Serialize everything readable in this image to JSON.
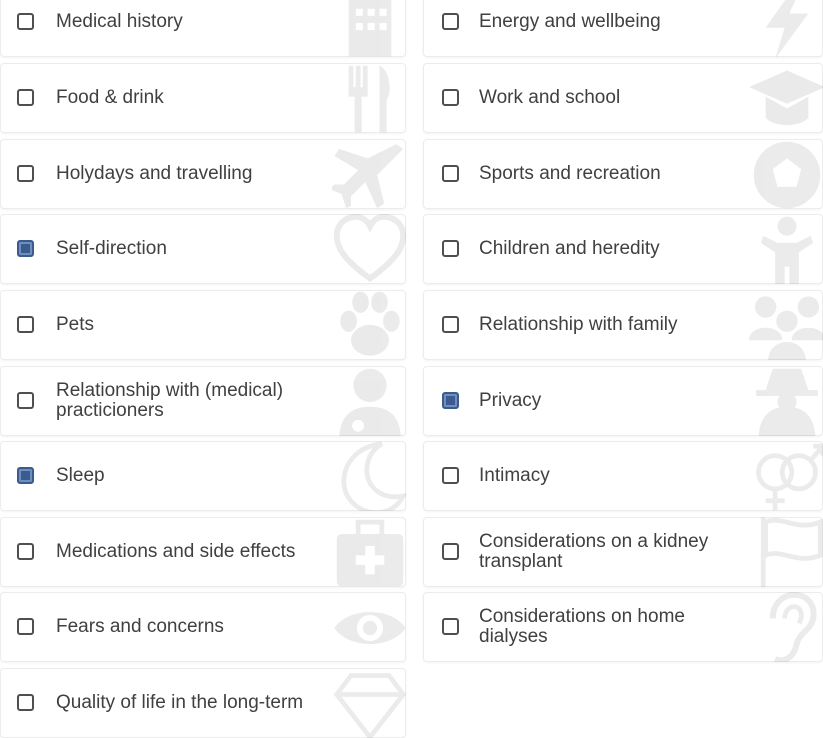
{
  "options_left": [
    {
      "label": "Medical history",
      "checked": false,
      "icon": "hospital-icon"
    },
    {
      "label": "Food & drink",
      "checked": false,
      "icon": "utensils-icon"
    },
    {
      "label": "Holydays and travelling",
      "checked": false,
      "icon": "plane-icon"
    },
    {
      "label": "Self-direction",
      "checked": true,
      "icon": "heart-icon"
    },
    {
      "label": "Pets",
      "checked": false,
      "icon": "paw-icon"
    },
    {
      "label": "Relationship with (medical) practicioners",
      "checked": false,
      "icon": "doctor-icon"
    },
    {
      "label": "Sleep",
      "checked": true,
      "icon": "moon-icon"
    },
    {
      "label": "Medications and side effects",
      "checked": false,
      "icon": "medkit-icon"
    },
    {
      "label": "Fears and concerns",
      "checked": false,
      "icon": "eye-icon"
    },
    {
      "label": "Quality of life in the long-term",
      "checked": false,
      "icon": "diamond-icon"
    }
  ],
  "options_right": [
    {
      "label": "Energy and wellbeing",
      "checked": false,
      "icon": "lightning-icon"
    },
    {
      "label": "Work and school",
      "checked": false,
      "icon": "graduation-cap-icon"
    },
    {
      "label": "Sports and recreation",
      "checked": false,
      "icon": "soccer-ball-icon"
    },
    {
      "label": "Children and heredity",
      "checked": false,
      "icon": "child-icon"
    },
    {
      "label": "Relationship with family",
      "checked": false,
      "icon": "family-icon"
    },
    {
      "label": "Privacy",
      "checked": true,
      "icon": "spy-icon"
    },
    {
      "label": "Intimacy",
      "checked": false,
      "icon": "gender-rings-icon"
    },
    {
      "label": "Considerations on a kidney transplant",
      "checked": false,
      "icon": "flag-icon"
    },
    {
      "label": "Considerations on home dialyses",
      "checked": false,
      "icon": "hearing-icon"
    }
  ],
  "colors": {
    "checked_fill": "#3b5b8f",
    "text": "#404040",
    "card_border": "#ececec"
  }
}
